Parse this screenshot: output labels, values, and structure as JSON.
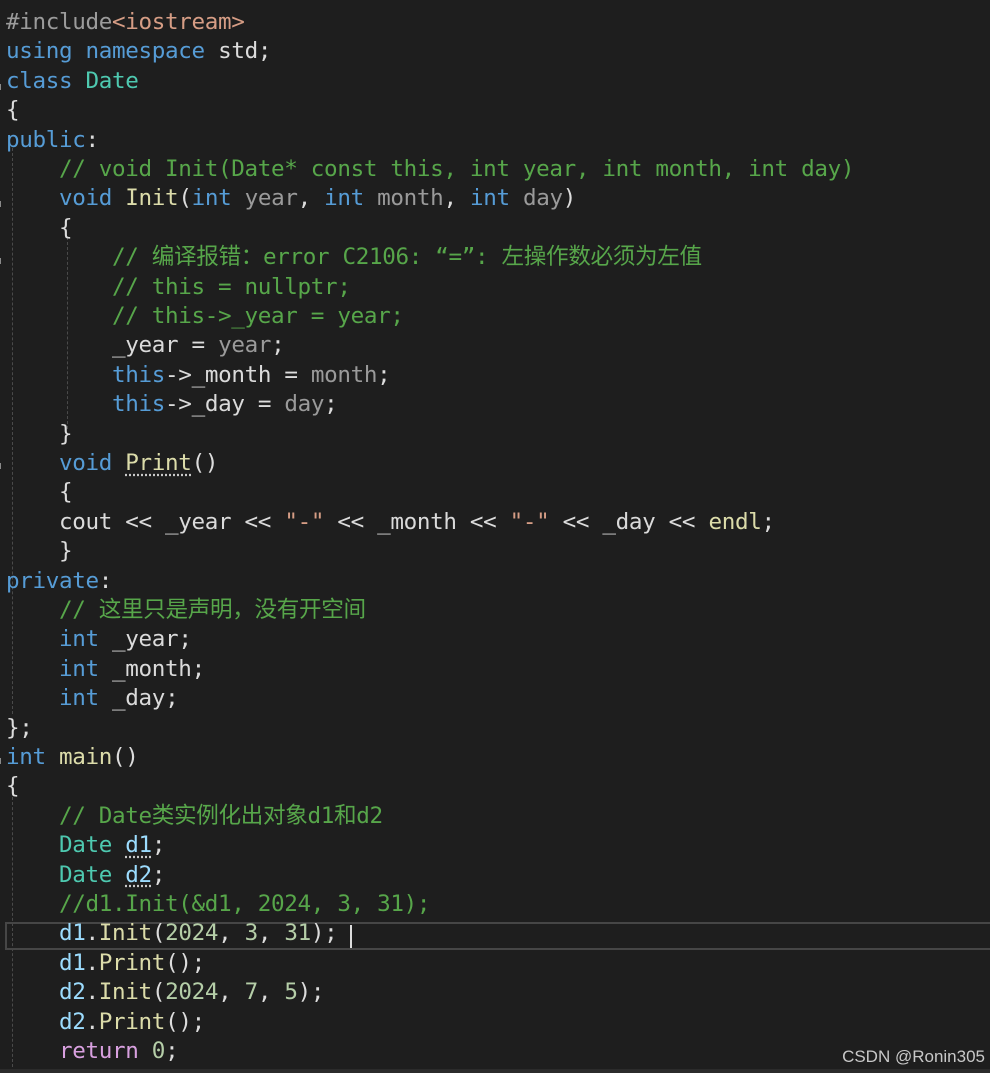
{
  "editor": {
    "lines": [
      [
        {
          "t": "#include",
          "k": "preproc"
        },
        {
          "t": "<iostream>",
          "k": "string"
        }
      ],
      [
        {
          "t": "using",
          "k": "keyword"
        },
        {
          "t": " ",
          "k": "plain"
        },
        {
          "t": "namespace",
          "k": "keyword"
        },
        {
          "t": " std;",
          "k": "plain"
        }
      ],
      [
        {
          "t": "class",
          "k": "keyword"
        },
        {
          "t": " ",
          "k": "plain"
        },
        {
          "t": "Date",
          "k": "type"
        }
      ],
      [
        {
          "t": "{",
          "k": "plain"
        }
      ],
      [
        {
          "t": "public",
          "k": "keyword"
        },
        {
          "t": ":",
          "k": "plain"
        }
      ],
      [
        {
          "t": "    // void Init(Date* const this, int year, int month, int day)",
          "k": "comment"
        }
      ],
      [
        {
          "t": "    ",
          "k": "plain"
        },
        {
          "t": "void",
          "k": "keyword"
        },
        {
          "t": " ",
          "k": "plain"
        },
        {
          "t": "Init",
          "k": "func"
        },
        {
          "t": "(",
          "k": "plain"
        },
        {
          "t": "int",
          "k": "keyword"
        },
        {
          "t": " ",
          "k": "plain"
        },
        {
          "t": "year",
          "k": "param"
        },
        {
          "t": ", ",
          "k": "plain"
        },
        {
          "t": "int",
          "k": "keyword"
        },
        {
          "t": " ",
          "k": "plain"
        },
        {
          "t": "month",
          "k": "param"
        },
        {
          "t": ", ",
          "k": "plain"
        },
        {
          "t": "int",
          "k": "keyword"
        },
        {
          "t": " ",
          "k": "plain"
        },
        {
          "t": "day",
          "k": "param"
        },
        {
          "t": ")",
          "k": "plain"
        }
      ],
      [
        {
          "t": "    {",
          "k": "plain"
        }
      ],
      [
        {
          "t": "        // 编译报错：error C2106: “=”: 左操作数必须为左值",
          "k": "comment"
        }
      ],
      [
        {
          "t": "        // this = nullptr;",
          "k": "comment"
        }
      ],
      [
        {
          "t": "        // this->_year = year;",
          "k": "comment"
        }
      ],
      [
        {
          "t": "        ",
          "k": "plain"
        },
        {
          "t": "_year",
          "k": "member"
        },
        {
          "t": " = ",
          "k": "plain"
        },
        {
          "t": "year",
          "k": "param"
        },
        {
          "t": ";",
          "k": "plain"
        }
      ],
      [
        {
          "t": "        ",
          "k": "plain"
        },
        {
          "t": "this",
          "k": "keyword"
        },
        {
          "t": "->",
          "k": "plain"
        },
        {
          "t": "_month",
          "k": "member"
        },
        {
          "t": " = ",
          "k": "plain"
        },
        {
          "t": "month",
          "k": "param"
        },
        {
          "t": ";",
          "k": "plain"
        }
      ],
      [
        {
          "t": "        ",
          "k": "plain"
        },
        {
          "t": "this",
          "k": "keyword"
        },
        {
          "t": "->",
          "k": "plain"
        },
        {
          "t": "_day",
          "k": "member"
        },
        {
          "t": " = ",
          "k": "plain"
        },
        {
          "t": "day",
          "k": "param"
        },
        {
          "t": ";",
          "k": "plain"
        }
      ],
      [
        {
          "t": "    }",
          "k": "plain"
        }
      ],
      [
        {
          "t": "    ",
          "k": "plain"
        },
        {
          "t": "void",
          "k": "keyword"
        },
        {
          "t": " ",
          "k": "plain"
        },
        {
          "t": "Print",
          "k": "func",
          "u": true
        },
        {
          "t": "()",
          "k": "plain"
        }
      ],
      [
        {
          "t": "    {",
          "k": "plain"
        }
      ],
      [
        {
          "t": "    cout << ",
          "k": "plain"
        },
        {
          "t": "_year",
          "k": "member"
        },
        {
          "t": " << ",
          "k": "plain"
        },
        {
          "t": "\"-\"",
          "k": "string"
        },
        {
          "t": " << ",
          "k": "plain"
        },
        {
          "t": "_month",
          "k": "member"
        },
        {
          "t": " << ",
          "k": "plain"
        },
        {
          "t": "\"-\"",
          "k": "string"
        },
        {
          "t": " << ",
          "k": "plain"
        },
        {
          "t": "_day",
          "k": "member"
        },
        {
          "t": " << ",
          "k": "plain"
        },
        {
          "t": "endl",
          "k": "func"
        },
        {
          "t": ";",
          "k": "plain"
        }
      ],
      [
        {
          "t": "    }",
          "k": "plain"
        }
      ],
      [
        {
          "t": "private",
          "k": "keyword"
        },
        {
          "t": ":",
          "k": "plain"
        }
      ],
      [
        {
          "t": "    // 这里只是声明，没有开空间",
          "k": "comment"
        }
      ],
      [
        {
          "t": "    ",
          "k": "plain"
        },
        {
          "t": "int",
          "k": "keyword"
        },
        {
          "t": " ",
          "k": "plain"
        },
        {
          "t": "_year",
          "k": "member"
        },
        {
          "t": ";",
          "k": "plain"
        }
      ],
      [
        {
          "t": "    ",
          "k": "plain"
        },
        {
          "t": "int",
          "k": "keyword"
        },
        {
          "t": " ",
          "k": "plain"
        },
        {
          "t": "_month",
          "k": "member"
        },
        {
          "t": ";",
          "k": "plain"
        }
      ],
      [
        {
          "t": "    ",
          "k": "plain"
        },
        {
          "t": "int",
          "k": "keyword"
        },
        {
          "t": " ",
          "k": "plain"
        },
        {
          "t": "_day",
          "k": "member"
        },
        {
          "t": ";",
          "k": "plain"
        }
      ],
      [
        {
          "t": "};",
          "k": "plain"
        }
      ],
      [
        {
          "t": "int",
          "k": "keyword"
        },
        {
          "t": " ",
          "k": "plain"
        },
        {
          "t": "main",
          "k": "func"
        },
        {
          "t": "()",
          "k": "plain"
        }
      ],
      [
        {
          "t": "{",
          "k": "plain"
        }
      ],
      [
        {
          "t": "    // Date类实例化出对象d1和d2",
          "k": "comment"
        }
      ],
      [
        {
          "t": "    ",
          "k": "plain"
        },
        {
          "t": "Date",
          "k": "type"
        },
        {
          "t": " ",
          "k": "plain"
        },
        {
          "t": "d1",
          "k": "var",
          "u": true
        },
        {
          "t": ";",
          "k": "plain"
        }
      ],
      [
        {
          "t": "    ",
          "k": "plain"
        },
        {
          "t": "Date",
          "k": "type"
        },
        {
          "t": " ",
          "k": "plain"
        },
        {
          "t": "d2",
          "k": "var",
          "u": true
        },
        {
          "t": ";",
          "k": "plain"
        }
      ],
      [
        {
          "t": "    //d1.Init(&d1, 2024, 3, 31);",
          "k": "comment"
        }
      ],
      [
        {
          "t": "    ",
          "k": "plain"
        },
        {
          "t": "d1",
          "k": "var"
        },
        {
          "t": ".",
          "k": "plain"
        },
        {
          "t": "Init",
          "k": "func"
        },
        {
          "t": "(",
          "k": "plain"
        },
        {
          "t": "2024",
          "k": "number"
        },
        {
          "t": ", ",
          "k": "plain"
        },
        {
          "t": "3",
          "k": "number"
        },
        {
          "t": ", ",
          "k": "plain"
        },
        {
          "t": "31",
          "k": "number"
        },
        {
          "t": ");",
          "k": "plain"
        }
      ],
      [
        {
          "t": "    ",
          "k": "plain"
        },
        {
          "t": "d1",
          "k": "var"
        },
        {
          "t": ".",
          "k": "plain"
        },
        {
          "t": "Print",
          "k": "func"
        },
        {
          "t": "();",
          "k": "plain"
        }
      ],
      [
        {
          "t": "    ",
          "k": "plain"
        },
        {
          "t": "d2",
          "k": "var"
        },
        {
          "t": ".",
          "k": "plain"
        },
        {
          "t": "Init",
          "k": "func"
        },
        {
          "t": "(",
          "k": "plain"
        },
        {
          "t": "2024",
          "k": "number"
        },
        {
          "t": ", ",
          "k": "plain"
        },
        {
          "t": "7",
          "k": "number"
        },
        {
          "t": ", ",
          "k": "plain"
        },
        {
          "t": "5",
          "k": "number"
        },
        {
          "t": ");",
          "k": "plain"
        }
      ],
      [
        {
          "t": "    ",
          "k": "plain"
        },
        {
          "t": "d2",
          "k": "var"
        },
        {
          "t": ".",
          "k": "plain"
        },
        {
          "t": "Print",
          "k": "func"
        },
        {
          "t": "();",
          "k": "plain"
        }
      ],
      [
        {
          "t": "    ",
          "k": "plain"
        },
        {
          "t": "return",
          "k": "control"
        },
        {
          "t": " ",
          "k": "plain"
        },
        {
          "t": "0",
          "k": "number"
        },
        {
          "t": ";",
          "k": "plain"
        }
      ]
    ]
  },
  "watermark": "CSDN @Ronin305",
  "colors": {
    "background": "#1e1e1e",
    "keyword": "#569cd6",
    "type": "#4ec9b0",
    "function": "#dcdcaa",
    "string": "#d69d85",
    "comment": "#57a64a",
    "number": "#b5cea8",
    "control": "#d8a0df",
    "variable": "#9cdcfe",
    "parameter": "#9a9a9a"
  }
}
